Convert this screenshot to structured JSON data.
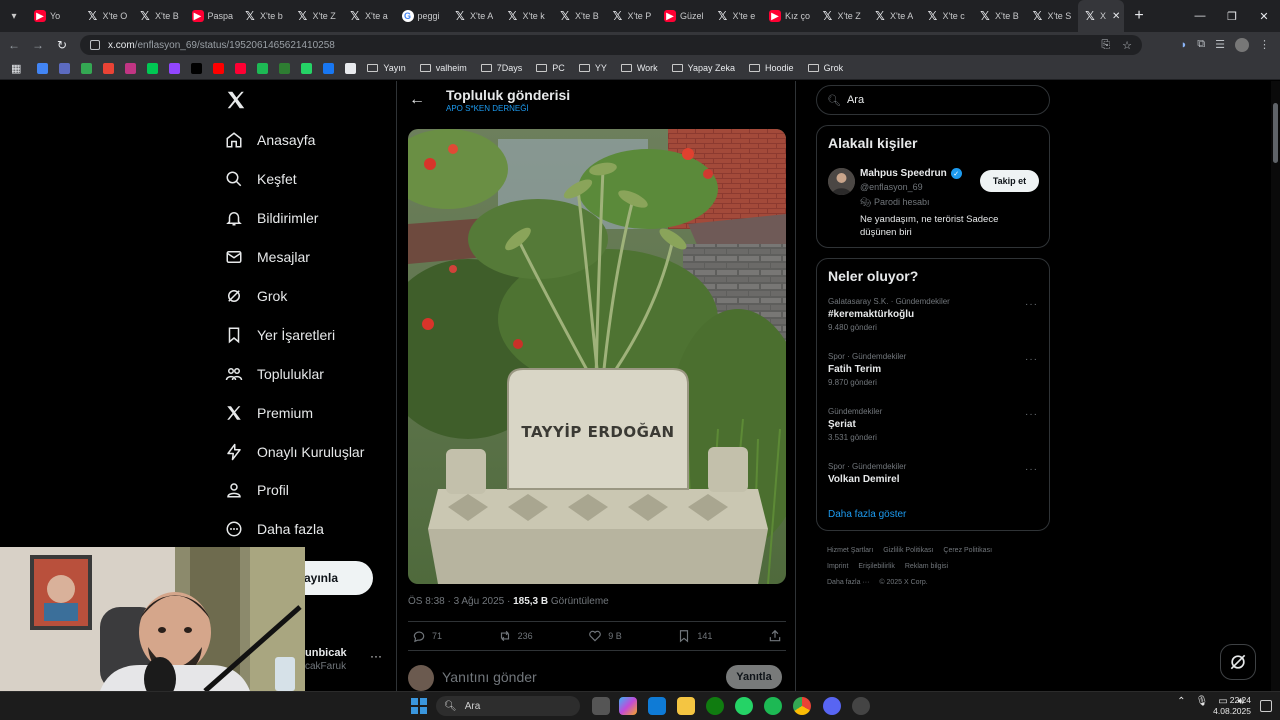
{
  "browser": {
    "tabs": [
      {
        "label": "Yo",
        "icon": "youtube-icon"
      },
      {
        "label": "X'te O",
        "icon": "x-icon"
      },
      {
        "label": "X'te B",
        "icon": "x-icon"
      },
      {
        "label": "Paspa",
        "icon": "youtube-icon"
      },
      {
        "label": "X'te b",
        "icon": "x-icon"
      },
      {
        "label": "X'te Z",
        "icon": "x-icon"
      },
      {
        "label": "X'te a",
        "icon": "x-icon"
      },
      {
        "label": "peggi",
        "icon": "google-icon"
      },
      {
        "label": "X'te A",
        "icon": "x-icon"
      },
      {
        "label": "X'te k",
        "icon": "x-icon"
      },
      {
        "label": "X'te B",
        "icon": "x-icon"
      },
      {
        "label": "X'te P",
        "icon": "x-icon"
      },
      {
        "label": "Güzel",
        "icon": "youtube-icon"
      },
      {
        "label": "X'te e",
        "icon": "x-icon"
      },
      {
        "label": "Kız ço",
        "icon": "youtube-icon"
      },
      {
        "label": "X'te Z",
        "icon": "x-icon"
      },
      {
        "label": "X'te A",
        "icon": "x-icon"
      },
      {
        "label": "X'te c",
        "icon": "x-icon"
      },
      {
        "label": "X'te B",
        "icon": "x-icon"
      },
      {
        "label": "X'te S",
        "icon": "x-icon"
      }
    ],
    "active_tab": {
      "label": "X",
      "icon": "x-icon"
    },
    "url_host": "x.com",
    "url_path": "/enflasyon_69/status/1952061465621410258",
    "bookmarks": [
      {
        "label": "Yayın"
      },
      {
        "label": "valheim"
      },
      {
        "label": "7Days"
      },
      {
        "label": "PC"
      },
      {
        "label": "YY"
      },
      {
        "label": "Work"
      },
      {
        "label": "Yapay Zeka"
      },
      {
        "label": "Hoodie"
      },
      {
        "label": "Grok"
      }
    ],
    "bookmark_icon_colors": [
      "#4285f4",
      "#5c6bc0",
      "#34a853",
      "#ea4335",
      "#c13584",
      "#00c853",
      "#9146ff",
      "#000000",
      "#ff0000",
      "#ff0033",
      "#1db954",
      "#2e7d32",
      "#25d366",
      "#1877f2",
      "#e8eaed",
      "#1976d2",
      "#ff6d00",
      "#d32f2f",
      "#43a047",
      "#ab47bc",
      "#1565c0",
      "#ffffff"
    ]
  },
  "nav": {
    "items": [
      {
        "label": "Anasayfa",
        "icon": "home-icon"
      },
      {
        "label": "Keşfet",
        "icon": "search-icon"
      },
      {
        "label": "Bildirimler",
        "icon": "bell-icon"
      },
      {
        "label": "Mesajlar",
        "icon": "envelope-icon"
      },
      {
        "label": "Grok",
        "icon": "grok-icon"
      },
      {
        "label": "Yer İşaretleri",
        "icon": "bookmark-icon"
      },
      {
        "label": "Topluluklar",
        "icon": "communities-icon"
      },
      {
        "label": "Premium",
        "icon": "x-icon"
      },
      {
        "label": "Onaylı Kuruluşlar",
        "icon": "lightning-icon"
      },
      {
        "label": "Profil",
        "icon": "person-icon"
      },
      {
        "label": "Daha fazla",
        "icon": "more-circle-icon"
      }
    ],
    "post_button_label": "ayınla",
    "account": {
      "name": "unbicak",
      "handle": "cakFaruk"
    }
  },
  "post": {
    "header_title": "Topluluk gönderisi",
    "header_subtitle": "APO S*KEN DERNEĞİ",
    "image_text": "TAYYİP ERDOĞAN",
    "time": "ÖS 8:38",
    "date": "3 Ağu 2025",
    "views_count": "185,3 B",
    "views_label": "Görüntüleme",
    "replies": "71",
    "reposts": "236",
    "likes": "9 B",
    "bookmarks": "141",
    "reply_placeholder": "Yanıtını gönder",
    "reply_button": "Yanıtla"
  },
  "sidebar": {
    "search_placeholder": "Ara",
    "people_title": "Alakalı kişiler",
    "person": {
      "name": "Mahpus Speedrun",
      "handle": "@enflasyon_69",
      "parody_label": "Parodi hesabı",
      "bio": "Ne yandaşım, ne terörist Sadece düşünen biri",
      "follow_label": "Takip et"
    },
    "trends_title": "Neler oluyor?",
    "trends": [
      {
        "context": "Galatasaray S.K. · Gündemdekiler",
        "name": "#keremaktürkoğlu",
        "count": "9.480 gönderi"
      },
      {
        "context": "Spor · Gündemdekiler",
        "name": "Fatih Terim",
        "count": "9.870 gönderi"
      },
      {
        "context": "Gündemdekiler",
        "name": "Şeriat",
        "count": "3.531 gönderi"
      },
      {
        "context": "Spor · Gündemdekiler",
        "name": "Volkan Demirel",
        "count": ""
      }
    ],
    "show_more": "Daha fazla göster",
    "footer": [
      "Hizmet Şartları",
      "Gizlilik Politikası",
      "Çerez Politikası",
      "Imprint",
      "Erişilebilirlik",
      "Reklam bilgisi",
      "Daha fazla ···",
      "© 2025 X Corp."
    ]
  },
  "taskbar": {
    "search_placeholder": "Ara",
    "time": "22:24",
    "date": "4.08.2025"
  },
  "colors": {
    "accent": "#1d9bf0",
    "background": "#000000",
    "text_primary": "#e7e9ea",
    "text_secondary": "#71767b",
    "border": "#2f3336"
  }
}
